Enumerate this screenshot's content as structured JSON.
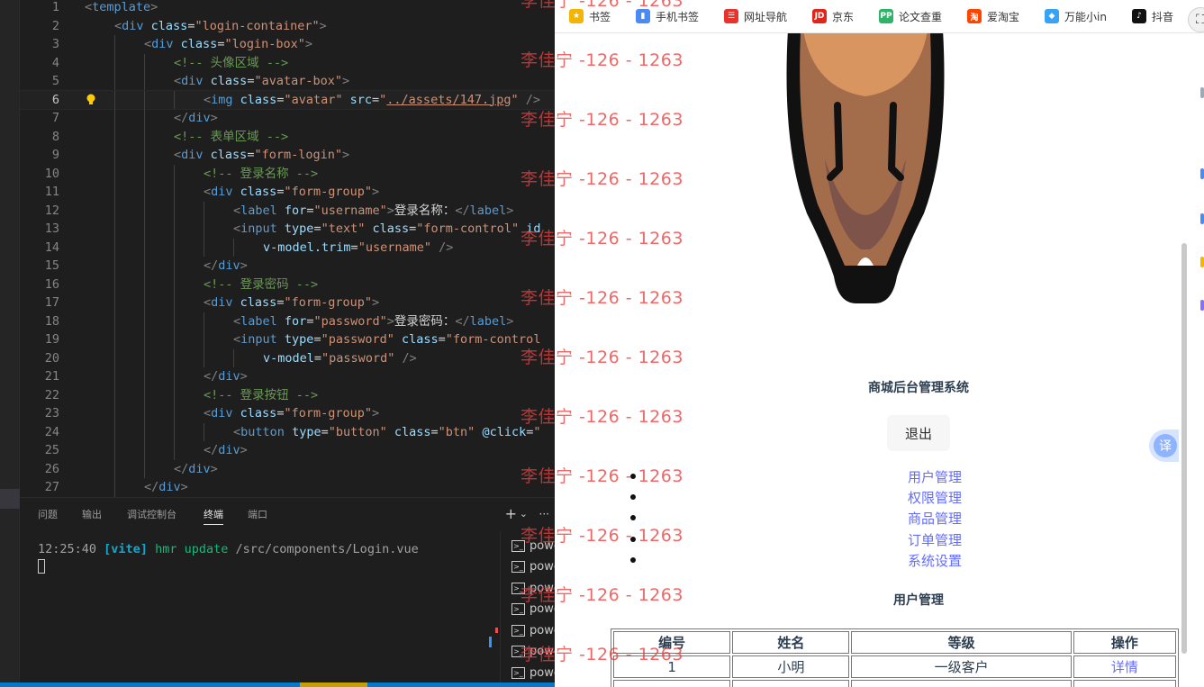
{
  "editor": {
    "code_lines": [
      {
        "no": "1",
        "indent": 0,
        "tokens": [
          [
            "punc",
            "<"
          ],
          [
            "tag",
            "template"
          ],
          [
            "punc",
            ">"
          ]
        ]
      },
      {
        "no": "2",
        "indent": 1,
        "tokens": [
          [
            "punc",
            "<"
          ],
          [
            "tag",
            "div"
          ],
          [
            "txt",
            " "
          ],
          [
            "attr",
            "class"
          ],
          [
            "txt",
            "="
          ],
          [
            "str",
            "\"login-container\""
          ],
          [
            "punc",
            ">"
          ]
        ]
      },
      {
        "no": "3",
        "indent": 2,
        "tokens": [
          [
            "punc",
            "<"
          ],
          [
            "tag",
            "div"
          ],
          [
            "txt",
            " "
          ],
          [
            "attr",
            "class"
          ],
          [
            "txt",
            "="
          ],
          [
            "str",
            "\"login-box\""
          ],
          [
            "punc",
            ">"
          ]
        ]
      },
      {
        "no": "4",
        "indent": 3,
        "tokens": [
          [
            "com",
            "<!-- 头像区域 -->"
          ]
        ]
      },
      {
        "no": "5",
        "indent": 3,
        "tokens": [
          [
            "punc",
            "<"
          ],
          [
            "tag",
            "div"
          ],
          [
            "txt",
            " "
          ],
          [
            "attr",
            "class"
          ],
          [
            "txt",
            "="
          ],
          [
            "str",
            "\"avatar-box\""
          ],
          [
            "punc",
            ">"
          ]
        ]
      },
      {
        "no": "6",
        "indent": 4,
        "tokens": [
          [
            "punc",
            "<"
          ],
          [
            "tag",
            "img"
          ],
          [
            "txt",
            " "
          ],
          [
            "attr",
            "class"
          ],
          [
            "txt",
            "="
          ],
          [
            "str",
            "\"avatar\""
          ],
          [
            "txt",
            " "
          ],
          [
            "attr",
            "src"
          ],
          [
            "txt",
            "="
          ],
          [
            "str",
            "\""
          ],
          [
            "link",
            "../assets/147.jpg"
          ],
          [
            "str",
            "\""
          ],
          [
            "txt",
            " "
          ],
          [
            "punc",
            "/>"
          ]
        ]
      },
      {
        "no": "7",
        "indent": 3,
        "tokens": [
          [
            "punc",
            "</"
          ],
          [
            "tag",
            "div"
          ],
          [
            "punc",
            ">"
          ]
        ]
      },
      {
        "no": "8",
        "indent": 3,
        "tokens": [
          [
            "com",
            "<!-- 表单区域 -->"
          ]
        ]
      },
      {
        "no": "9",
        "indent": 3,
        "tokens": [
          [
            "punc",
            "<"
          ],
          [
            "tag",
            "div"
          ],
          [
            "txt",
            " "
          ],
          [
            "attr",
            "class"
          ],
          [
            "txt",
            "="
          ],
          [
            "str",
            "\"form-login\""
          ],
          [
            "punc",
            ">"
          ]
        ]
      },
      {
        "no": "10",
        "indent": 4,
        "tokens": [
          [
            "com",
            "<!-- 登录名称 -->"
          ]
        ]
      },
      {
        "no": "11",
        "indent": 4,
        "tokens": [
          [
            "punc",
            "<"
          ],
          [
            "tag",
            "div"
          ],
          [
            "txt",
            " "
          ],
          [
            "attr",
            "class"
          ],
          [
            "txt",
            "="
          ],
          [
            "str",
            "\"form-group\""
          ],
          [
            "punc",
            ">"
          ]
        ]
      },
      {
        "no": "12",
        "indent": 5,
        "tokens": [
          [
            "punc",
            "<"
          ],
          [
            "tag",
            "label"
          ],
          [
            "txt",
            " "
          ],
          [
            "attr",
            "for"
          ],
          [
            "txt",
            "="
          ],
          [
            "str",
            "\"username\""
          ],
          [
            "punc",
            ">"
          ],
          [
            "txt",
            "登录名称："
          ],
          [
            "punc",
            "</"
          ],
          [
            "tag",
            "label"
          ],
          [
            "punc",
            ">"
          ]
        ]
      },
      {
        "no": "13",
        "indent": 5,
        "tokens": [
          [
            "punc",
            "<"
          ],
          [
            "tag",
            "input"
          ],
          [
            "txt",
            " "
          ],
          [
            "attr",
            "type"
          ],
          [
            "txt",
            "="
          ],
          [
            "str",
            "\"text\""
          ],
          [
            "txt",
            " "
          ],
          [
            "attr",
            "class"
          ],
          [
            "txt",
            "="
          ],
          [
            "str",
            "\"form-control\""
          ],
          [
            "txt",
            " "
          ],
          [
            "attr",
            "id"
          ]
        ]
      },
      {
        "no": "14",
        "indent": 6,
        "tokens": [
          [
            "dir",
            "v-model.trim"
          ],
          [
            "txt",
            "="
          ],
          [
            "str",
            "\"username\""
          ],
          [
            "txt",
            " "
          ],
          [
            "punc",
            "/>"
          ]
        ]
      },
      {
        "no": "15",
        "indent": 4,
        "tokens": [
          [
            "punc",
            "</"
          ],
          [
            "tag",
            "div"
          ],
          [
            "punc",
            ">"
          ]
        ]
      },
      {
        "no": "16",
        "indent": 4,
        "tokens": [
          [
            "com",
            "<!-- 登录密码 -->"
          ]
        ]
      },
      {
        "no": "17",
        "indent": 4,
        "tokens": [
          [
            "punc",
            "<"
          ],
          [
            "tag",
            "div"
          ],
          [
            "txt",
            " "
          ],
          [
            "attr",
            "class"
          ],
          [
            "txt",
            "="
          ],
          [
            "str",
            "\"form-group\""
          ],
          [
            "punc",
            ">"
          ]
        ]
      },
      {
        "no": "18",
        "indent": 5,
        "tokens": [
          [
            "punc",
            "<"
          ],
          [
            "tag",
            "label"
          ],
          [
            "txt",
            " "
          ],
          [
            "attr",
            "for"
          ],
          [
            "txt",
            "="
          ],
          [
            "str",
            "\"password\""
          ],
          [
            "punc",
            ">"
          ],
          [
            "txt",
            "登录密码："
          ],
          [
            "punc",
            "</"
          ],
          [
            "tag",
            "label"
          ],
          [
            "punc",
            ">"
          ]
        ]
      },
      {
        "no": "19",
        "indent": 5,
        "tokens": [
          [
            "punc",
            "<"
          ],
          [
            "tag",
            "input"
          ],
          [
            "txt",
            " "
          ],
          [
            "attr",
            "type"
          ],
          [
            "txt",
            "="
          ],
          [
            "str",
            "\"password\""
          ],
          [
            "txt",
            " "
          ],
          [
            "attr",
            "class"
          ],
          [
            "txt",
            "="
          ],
          [
            "str",
            "\"form-control"
          ]
        ]
      },
      {
        "no": "20",
        "indent": 6,
        "tokens": [
          [
            "dir",
            "v-model"
          ],
          [
            "txt",
            "="
          ],
          [
            "str",
            "\"password\""
          ],
          [
            "txt",
            " "
          ],
          [
            "punc",
            "/>"
          ]
        ]
      },
      {
        "no": "21",
        "indent": 4,
        "tokens": [
          [
            "punc",
            "</"
          ],
          [
            "tag",
            "div"
          ],
          [
            "punc",
            ">"
          ]
        ]
      },
      {
        "no": "22",
        "indent": 4,
        "tokens": [
          [
            "com",
            "<!-- 登录按钮 -->"
          ]
        ]
      },
      {
        "no": "23",
        "indent": 4,
        "tokens": [
          [
            "punc",
            "<"
          ],
          [
            "tag",
            "div"
          ],
          [
            "txt",
            " "
          ],
          [
            "attr",
            "class"
          ],
          [
            "txt",
            "="
          ],
          [
            "str",
            "\"form-group\""
          ],
          [
            "punc",
            ">"
          ]
        ]
      },
      {
        "no": "24",
        "indent": 5,
        "tokens": [
          [
            "punc",
            "<"
          ],
          [
            "tag",
            "button"
          ],
          [
            "txt",
            " "
          ],
          [
            "attr",
            "type"
          ],
          [
            "txt",
            "="
          ],
          [
            "str",
            "\"button\""
          ],
          [
            "txt",
            " "
          ],
          [
            "attr",
            "class"
          ],
          [
            "txt",
            "="
          ],
          [
            "str",
            "\"btn\""
          ],
          [
            "txt",
            " "
          ],
          [
            "dir",
            "@click"
          ],
          [
            "txt",
            "="
          ],
          [
            "str",
            "\""
          ]
        ]
      },
      {
        "no": "25",
        "indent": 4,
        "tokens": [
          [
            "punc",
            "</"
          ],
          [
            "tag",
            "div"
          ],
          [
            "punc",
            ">"
          ]
        ]
      },
      {
        "no": "26",
        "indent": 3,
        "tokens": [
          [
            "punc",
            "</"
          ],
          [
            "tag",
            "div"
          ],
          [
            "punc",
            ">"
          ]
        ]
      },
      {
        "no": "27",
        "indent": 2,
        "tokens": [
          [
            "punc",
            "</"
          ],
          [
            "tag",
            "div"
          ],
          [
            "punc",
            ">"
          ]
        ]
      }
    ],
    "current_line": "6",
    "lightbulb_icon": "lightbulb-icon"
  },
  "panel": {
    "tabs": [
      {
        "label": "问题",
        "active": false
      },
      {
        "label": "输出",
        "active": false
      },
      {
        "label": "调试控制台",
        "active": false
      },
      {
        "label": "终端",
        "active": true
      },
      {
        "label": "端口",
        "active": false
      }
    ],
    "actions": {
      "add": "+",
      "dropdown": "⌄",
      "more": "···"
    },
    "terminal": {
      "time": "12:25:40",
      "tool": "[vite]",
      "event": "hmr update",
      "path": "/src/components/Login.vue"
    },
    "terminal_instances": [
      "powe",
      "powe",
      "powe",
      "powe",
      "powe",
      "powe",
      "powe"
    ]
  },
  "browser": {
    "bookmarks": [
      {
        "label": "书签",
        "icon": "star-icon",
        "color": "#f5b400"
      },
      {
        "label": "手机书签",
        "icon": "phone-bookmark-icon",
        "color": "#4a8af4"
      },
      {
        "label": "网址导航",
        "icon": "nav-icon",
        "color": "#e8332d"
      },
      {
        "label": "京东",
        "icon": "jd-icon",
        "color": "#e1251b"
      },
      {
        "label": "论文查重",
        "icon": "pp-icon",
        "color": "#2fb36b"
      },
      {
        "label": "爱淘宝",
        "icon": "taobao-icon",
        "color": "#ff4400"
      },
      {
        "label": "万能小in",
        "icon": "xiaoin-icon",
        "color": "#36a3f7"
      },
      {
        "label": "抖音",
        "icon": "douyin-icon",
        "color": "#111111"
      }
    ],
    "page": {
      "title": "商城后台管理系统",
      "logout": "退出",
      "menu": [
        "用户管理",
        "权限管理",
        "商品管理",
        "订单管理",
        "系统设置"
      ],
      "section_title": "用户管理",
      "table": {
        "headers": [
          "编号",
          "姓名",
          "等级",
          "操作"
        ],
        "rows": [
          [
            "1",
            "小明",
            "一级客户",
            "详情"
          ]
        ]
      }
    },
    "translate_label": "译"
  },
  "watermark": "李佳宁 -126 - 1263",
  "colors": {
    "link": "#646cff",
    "editor_bg": "#1e1e1e",
    "status_bar": "#007acc",
    "watermark": "#eb3c3c"
  }
}
